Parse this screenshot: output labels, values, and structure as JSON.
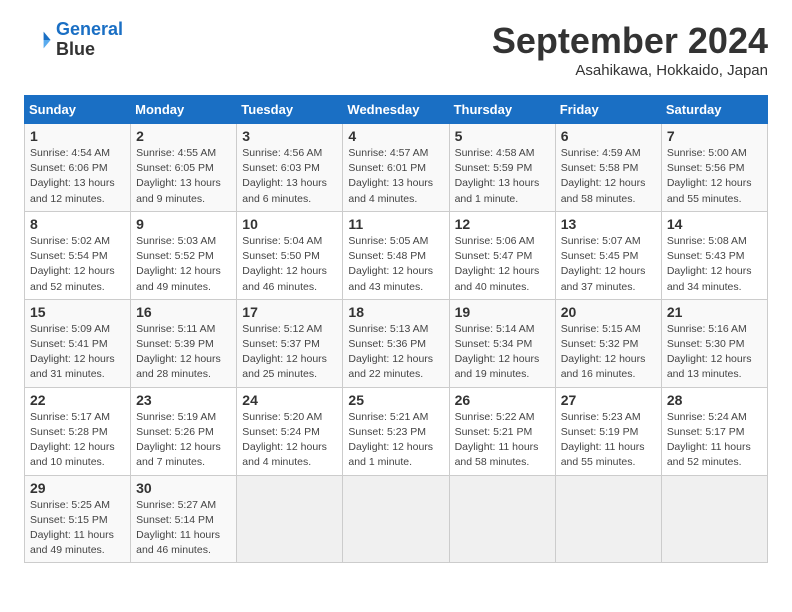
{
  "header": {
    "logo_line1": "General",
    "logo_line2": "Blue",
    "month": "September 2024",
    "location": "Asahikawa, Hokkaido, Japan"
  },
  "days_of_week": [
    "Sunday",
    "Monday",
    "Tuesday",
    "Wednesday",
    "Thursday",
    "Friday",
    "Saturday"
  ],
  "weeks": [
    [
      {
        "day": 1,
        "sunrise": "4:54 AM",
        "sunset": "6:06 PM",
        "daylight": "13 hours and 12 minutes."
      },
      {
        "day": 2,
        "sunrise": "4:55 AM",
        "sunset": "6:05 PM",
        "daylight": "13 hours and 9 minutes."
      },
      {
        "day": 3,
        "sunrise": "4:56 AM",
        "sunset": "6:03 PM",
        "daylight": "13 hours and 6 minutes."
      },
      {
        "day": 4,
        "sunrise": "4:57 AM",
        "sunset": "6:01 PM",
        "daylight": "13 hours and 4 minutes."
      },
      {
        "day": 5,
        "sunrise": "4:58 AM",
        "sunset": "5:59 PM",
        "daylight": "13 hours and 1 minute."
      },
      {
        "day": 6,
        "sunrise": "4:59 AM",
        "sunset": "5:58 PM",
        "daylight": "12 hours and 58 minutes."
      },
      {
        "day": 7,
        "sunrise": "5:00 AM",
        "sunset": "5:56 PM",
        "daylight": "12 hours and 55 minutes."
      }
    ],
    [
      {
        "day": 8,
        "sunrise": "5:02 AM",
        "sunset": "5:54 PM",
        "daylight": "12 hours and 52 minutes."
      },
      {
        "day": 9,
        "sunrise": "5:03 AM",
        "sunset": "5:52 PM",
        "daylight": "12 hours and 49 minutes."
      },
      {
        "day": 10,
        "sunrise": "5:04 AM",
        "sunset": "5:50 PM",
        "daylight": "12 hours and 46 minutes."
      },
      {
        "day": 11,
        "sunrise": "5:05 AM",
        "sunset": "5:48 PM",
        "daylight": "12 hours and 43 minutes."
      },
      {
        "day": 12,
        "sunrise": "5:06 AM",
        "sunset": "5:47 PM",
        "daylight": "12 hours and 40 minutes."
      },
      {
        "day": 13,
        "sunrise": "5:07 AM",
        "sunset": "5:45 PM",
        "daylight": "12 hours and 37 minutes."
      },
      {
        "day": 14,
        "sunrise": "5:08 AM",
        "sunset": "5:43 PM",
        "daylight": "12 hours and 34 minutes."
      }
    ],
    [
      {
        "day": 15,
        "sunrise": "5:09 AM",
        "sunset": "5:41 PM",
        "daylight": "12 hours and 31 minutes."
      },
      {
        "day": 16,
        "sunrise": "5:11 AM",
        "sunset": "5:39 PM",
        "daylight": "12 hours and 28 minutes."
      },
      {
        "day": 17,
        "sunrise": "5:12 AM",
        "sunset": "5:37 PM",
        "daylight": "12 hours and 25 minutes."
      },
      {
        "day": 18,
        "sunrise": "5:13 AM",
        "sunset": "5:36 PM",
        "daylight": "12 hours and 22 minutes."
      },
      {
        "day": 19,
        "sunrise": "5:14 AM",
        "sunset": "5:34 PM",
        "daylight": "12 hours and 19 minutes."
      },
      {
        "day": 20,
        "sunrise": "5:15 AM",
        "sunset": "5:32 PM",
        "daylight": "12 hours and 16 minutes."
      },
      {
        "day": 21,
        "sunrise": "5:16 AM",
        "sunset": "5:30 PM",
        "daylight": "12 hours and 13 minutes."
      }
    ],
    [
      {
        "day": 22,
        "sunrise": "5:17 AM",
        "sunset": "5:28 PM",
        "daylight": "12 hours and 10 minutes."
      },
      {
        "day": 23,
        "sunrise": "5:19 AM",
        "sunset": "5:26 PM",
        "daylight": "12 hours and 7 minutes."
      },
      {
        "day": 24,
        "sunrise": "5:20 AM",
        "sunset": "5:24 PM",
        "daylight": "12 hours and 4 minutes."
      },
      {
        "day": 25,
        "sunrise": "5:21 AM",
        "sunset": "5:23 PM",
        "daylight": "12 hours and 1 minute."
      },
      {
        "day": 26,
        "sunrise": "5:22 AM",
        "sunset": "5:21 PM",
        "daylight": "11 hours and 58 minutes."
      },
      {
        "day": 27,
        "sunrise": "5:23 AM",
        "sunset": "5:19 PM",
        "daylight": "11 hours and 55 minutes."
      },
      {
        "day": 28,
        "sunrise": "5:24 AM",
        "sunset": "5:17 PM",
        "daylight": "11 hours and 52 minutes."
      }
    ],
    [
      {
        "day": 29,
        "sunrise": "5:25 AM",
        "sunset": "5:15 PM",
        "daylight": "11 hours and 49 minutes."
      },
      {
        "day": 30,
        "sunrise": "5:27 AM",
        "sunset": "5:14 PM",
        "daylight": "11 hours and 46 minutes."
      },
      null,
      null,
      null,
      null,
      null
    ]
  ]
}
